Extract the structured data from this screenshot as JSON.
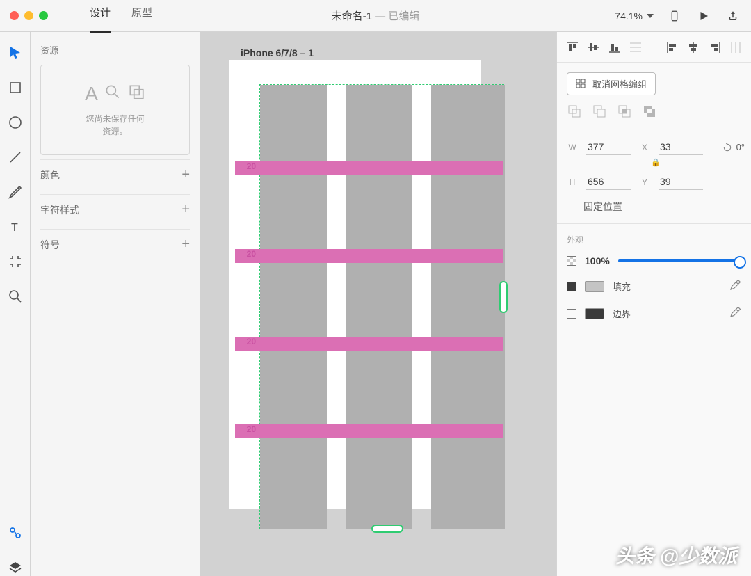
{
  "titlebar": {
    "tabs": {
      "design": "设计",
      "prototype": "原型"
    },
    "doc_name": "未命名-1",
    "doc_state": "已编辑",
    "zoom": "74.1%"
  },
  "left": {
    "assets_title": "资源",
    "assets_empty": "您尚未保存任何\n资源。",
    "sections": {
      "color": "颜色",
      "char_style": "字符样式",
      "symbol": "符号"
    }
  },
  "canvas": {
    "artboard_name": "iPhone 6/7/8 – 1",
    "row_gap": "20"
  },
  "right": {
    "ungroup_grid": "取消网格编组",
    "dims": {
      "w_label": "W",
      "w": "377",
      "x_label": "X",
      "x": "33",
      "h_label": "H",
      "h": "656",
      "y_label": "Y",
      "y": "39",
      "rot": "0°"
    },
    "fix_position": "固定位置",
    "appearance_title": "外观",
    "opacity": "100%",
    "fill_label": "填充",
    "border_label": "边界"
  },
  "watermark": "头条 @少数派"
}
